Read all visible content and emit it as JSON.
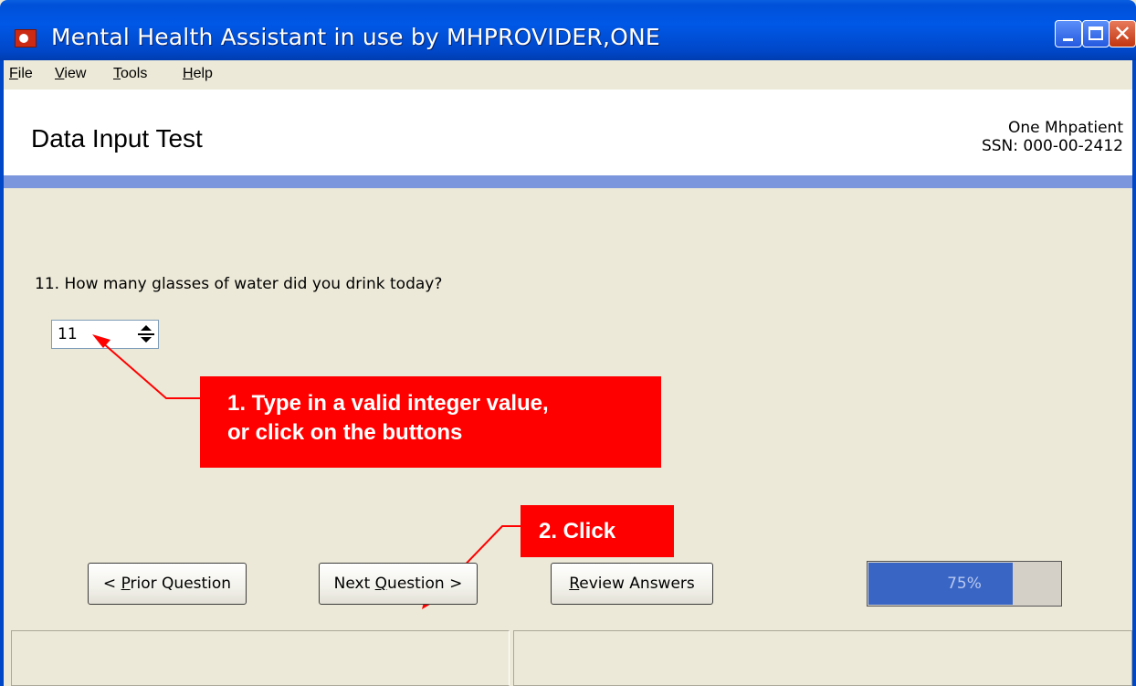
{
  "window": {
    "title": "Mental Health Assistant in use by MHPROVIDER,ONE",
    "close_glyph": "✕"
  },
  "menu": [
    {
      "label": "File",
      "mnemonic": "F",
      "rest": "ile"
    },
    {
      "label": "View",
      "mnemonic": "V",
      "rest": "iew"
    },
    {
      "label": "Tools",
      "mnemonic": "T",
      "rest": "ools"
    },
    {
      "label": "Help",
      "mnemonic": "H",
      "rest": "elp"
    }
  ],
  "header": {
    "title": "Data Input Test",
    "patient_name": "One Mhpatient",
    "patient_ssn": "SSN: 000-00-2412"
  },
  "question": {
    "text": "11. How many glasses of water did you drink today?",
    "value": "11"
  },
  "callouts": {
    "step1_line1": "1. Type in a valid integer value,",
    "step1_line2": "or click on the buttons",
    "step2": "2. Click"
  },
  "buttons": {
    "prior": {
      "pre": "< ",
      "mnemonic": "P",
      "rest": "rior Question"
    },
    "next": {
      "pre": "Next ",
      "mnemonic": "Q",
      "rest": "uestion >"
    },
    "review": {
      "pre": "",
      "mnemonic": "R",
      "rest": "eview Answers"
    }
  },
  "progress": {
    "value": 0.75,
    "label": "75%"
  },
  "colors": {
    "callout": "#ff0000",
    "progress_fill": "#3966c5",
    "title_bar": "#0058e6",
    "band": "#7b96dd"
  },
  "icons": [
    "app-icon",
    "minimize-icon",
    "maximize-icon",
    "close-icon",
    "spin-up-icon",
    "spin-down-icon"
  ]
}
